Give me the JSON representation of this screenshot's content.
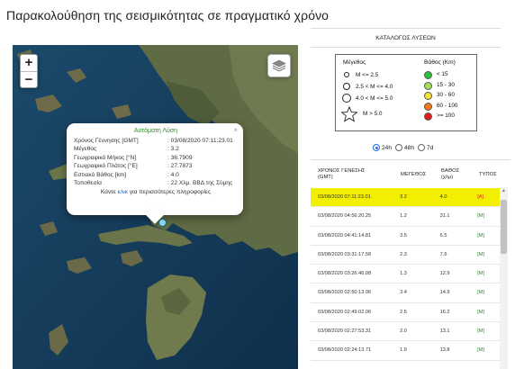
{
  "page": {
    "title": "Παρακολούθηση της σεισμικότητας σε πραγματικό χρόνο"
  },
  "map": {
    "zoom_in": "+",
    "zoom_out": "−",
    "layers_icon": "layers-icon",
    "popup": {
      "title": "Αυτόματη Λύση",
      "close": "×",
      "rows": [
        {
          "k": "Χρόνος Γέννησης [GMT]",
          "v": ": 03/08/2020 07:11:23.01"
        },
        {
          "k": "Μέγεθος",
          "v": ": 3.2"
        },
        {
          "k": "Γεωγραφικό Μήκος [°N]",
          "v": ": 36.7909"
        },
        {
          "k": "Γεωγραφικό Πλάτος [°E]",
          "v": ": 27.7873"
        },
        {
          "k": "Εστιακό Βάθος [km]",
          "v": ": 4.0"
        },
        {
          "k": "Τοποθεσία",
          "v": ": 22 Χλμ. ΒΒΔ της Σύμης"
        }
      ],
      "more_prefix": "Κάντε ",
      "more_link": "κλικ",
      "more_suffix": " για περισσότερες πληροφορίες"
    }
  },
  "catalog": {
    "title": "ΚΑΤΑΛΟΓΟΣ ΛΥΣΕΩΝ"
  },
  "legend": {
    "magnitude_title": "Μέγεθος",
    "magnitude_items": [
      "M <= 2.5",
      "2.5 < M <= 4.0",
      "4.0 < M <= 5.0",
      "M > 5.0"
    ],
    "depth_title": "Βάθος (Km)",
    "depth_items": [
      {
        "label": "< 15",
        "color": "#2bbf3a"
      },
      {
        "label": "15 - 30",
        "color": "#a6e05a"
      },
      {
        "label": "30 - 60",
        "color": "#f3e23a"
      },
      {
        "label": "60 - 100",
        "color": "#f07a1c"
      },
      {
        "label": ">= 100",
        "color": "#e01b1b"
      }
    ]
  },
  "period": {
    "options": [
      "24h",
      "48h",
      "7d"
    ],
    "selected": "24h"
  },
  "table": {
    "headers": {
      "time": "ΧΡΟΝΟΣ ΓΕΝΕΣΗΣ",
      "time_unit": "(GMT)",
      "mag": "ΜΕΓΕΘΟΣ",
      "depth": "ΒΑΘΟΣ",
      "depth_unit": "(χλμ)",
      "type": "ΤΥΠΟΣ"
    },
    "rows": [
      {
        "time": "03/08/2020 07:11:23.01",
        "mag": "3.2",
        "depth": "4.0",
        "type": "[A]"
      },
      {
        "time": "03/08/2020 04:56:20.25",
        "mag": "1.2",
        "depth": "31.1",
        "type": "[M]"
      },
      {
        "time": "03/08/2020 04:41:14.81",
        "mag": "3.5",
        "depth": "6.5",
        "type": "[M]"
      },
      {
        "time": "03/08/2020 03:31:17.58",
        "mag": "2.3",
        "depth": "7.6",
        "type": "[M]"
      },
      {
        "time": "03/08/2020 03:26:46.08",
        "mag": "1.3",
        "depth": "12.9",
        "type": "[M]"
      },
      {
        "time": "03/08/2020 02:50:13.06",
        "mag": "3.4",
        "depth": "14.9",
        "type": "[M]"
      },
      {
        "time": "03/08/2020 02:49:02.06",
        "mag": "2.5",
        "depth": "16.2",
        "type": "[M]"
      },
      {
        "time": "03/08/2020 02:27:53.31",
        "mag": "2.0",
        "depth": "13.1",
        "type": "[M]"
      },
      {
        "time": "03/08/2020 02:24:13.71",
        "mag": "1.9",
        "depth": "13.8",
        "type": "[M]"
      }
    ]
  }
}
